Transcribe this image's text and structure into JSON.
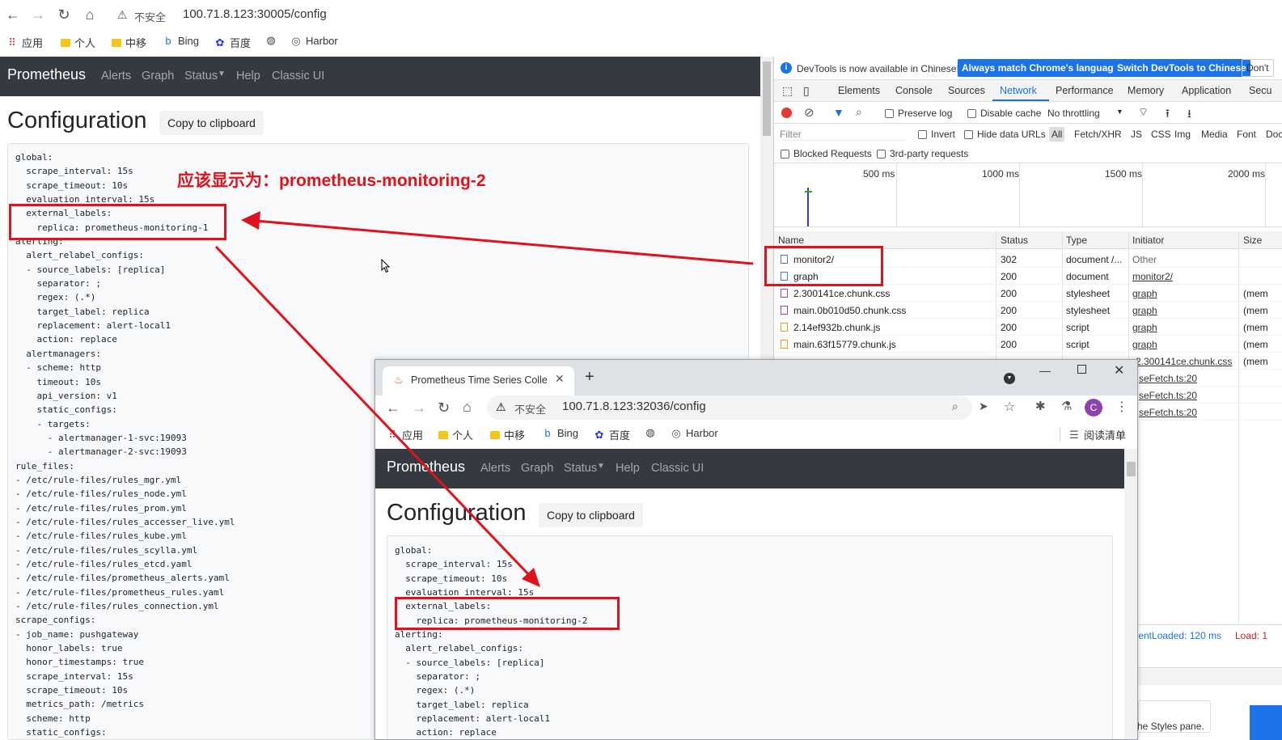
{
  "browser": {
    "url_warning": "不安全",
    "url": "100.71.8.123:30005/config",
    "bookmarks": [
      "应用",
      "个人",
      "中移",
      "Bing",
      "百度",
      "Harbor"
    ]
  },
  "prometheus": {
    "brand": "Prometheus",
    "nav": [
      "Alerts",
      "Graph",
      "Status",
      "Help",
      "Classic UI"
    ],
    "page_title": "Configuration",
    "copy_button": "Copy to clipboard",
    "config_text": "global:\n  scrape_interval: 15s\n  scrape_timeout: 10s\n  evaluation_interval: 15s\n  external_labels:\n    replica: prometheus-monitoring-1\nalerting:\n  alert_relabel_configs:\n  - source_labels: [replica]\n    separator: ;\n    regex: (.*)\n    target_label: replica\n    replacement: alert-local1\n    action: replace\n  alertmanagers:\n  - scheme: http\n    timeout: 10s\n    api_version: v1\n    static_configs:\n    - targets:\n      - alertmanager-1-svc:19093\n      - alertmanager-2-svc:19093\nrule_files:\n- /etc/rule-files/rules_mgr.yml\n- /etc/rule-files/rules_node.yml\n- /etc/rule-files/rules_prom.yml\n- /etc/rule-files/rules_accesser_live.yml\n- /etc/rule-files/rules_kube.yml\n- /etc/rule-files/rules_scylla.yml\n- /etc/rule-files/rules_etcd.yaml\n- /etc/rule-files/prometheus_alerts.yaml\n- /etc/rule-files/prometheus_rules.yaml\n- /etc/rule-files/rules_connection.yml\nscrape_configs:\n- job_name: pushgateway\n  honor_labels: true\n  honor_timestamps: true\n  scrape_interval: 15s\n  scrape_timeout: 10s\n  metrics_path: /metrics\n  scheme: http\n  static_configs:"
  },
  "annotation": {
    "text": "应该显示为：prometheus-monitoring-2",
    "color": "#e0131c"
  },
  "devtools": {
    "banner": "DevTools is now available in Chinese!",
    "banner_btn1": "Always match Chrome's language",
    "banner_btn2": "Switch DevTools to Chinese",
    "banner_btn3": "Don't",
    "tabs": [
      "Elements",
      "Console",
      "Sources",
      "Network",
      "Performance",
      "Memory",
      "Application",
      "Secu"
    ],
    "active_tab": "Network",
    "preserve_log": "Preserve log",
    "disable_cache": "Disable cache",
    "throttling": "No throttling",
    "filter_placeholder": "Filter",
    "invert": "Invert",
    "hide_data_urls": "Hide data URLs",
    "type_filters": [
      "All",
      "Fetch/XHR",
      "JS",
      "CSS",
      "Img",
      "Media",
      "Font",
      "Doc"
    ],
    "blocked_requests": "Blocked Requests",
    "third_party": "3rd-party requests",
    "timeline_ticks": [
      "500 ms",
      "1000 ms",
      "1500 ms",
      "2000 ms"
    ],
    "columns": [
      "Name",
      "Status",
      "Type",
      "Initiator",
      "Size"
    ],
    "rows": [
      {
        "name": "monitor2/",
        "status": "302",
        "type": "document /...",
        "initiator": "Other",
        "size": ""
      },
      {
        "name": "graph",
        "status": "200",
        "type": "document",
        "initiator": "monitor2/",
        "size": ""
      },
      {
        "name": "2.300141ce.chunk.css",
        "status": "200",
        "type": "stylesheet",
        "initiator": "graph",
        "size": "(mem"
      },
      {
        "name": "main.0b010d50.chunk.css",
        "status": "200",
        "type": "stylesheet",
        "initiator": "graph",
        "size": "(mem"
      },
      {
        "name": "2.14ef932b.chunk.js",
        "status": "200",
        "type": "script",
        "initiator": "graph",
        "size": "(mem"
      },
      {
        "name": "main.63f15779.chunk.js",
        "status": "200",
        "type": "script",
        "initiator": "graph",
        "size": "(mem"
      },
      {
        "name": "",
        "status": "",
        "type": "",
        "initiator": "2.300141ce.chunk.css",
        "size": "(mem"
      },
      {
        "name": "",
        "status": "",
        "type": "",
        "initiator": "seFetch.ts:20",
        "size": ""
      },
      {
        "name": "",
        "status": "",
        "type": "",
        "initiator": "seFetch.ts:20",
        "size": ""
      },
      {
        "name": "",
        "status": "",
        "type": "",
        "initiator": "seFetch.ts:20",
        "size": ""
      }
    ],
    "dom_loaded": "tentLoaded: 120 ms",
    "load": "Load: 1",
    "styles_hint": "he Styles pane."
  },
  "popup": {
    "tab_title": "Prometheus Time Series Colle",
    "url_warning": "不安全",
    "url": "100.71.8.123:32036/config",
    "bookmarks": [
      "应用",
      "个人",
      "中移",
      "Bing",
      "百度",
      "Harbor"
    ],
    "reading_list": "阅读清单",
    "profile_letter": "C",
    "config_text": "global:\n  scrape_interval: 15s\n  scrape_timeout: 10s\n  evaluation_interval: 15s\n  external_labels:\n    replica: prometheus-monitoring-2\nalerting:\n  alert_relabel_configs:\n  - source_labels: [replica]\n    separator: ;\n    regex: (.*)\n    target_label: replica\n    replacement: alert-local1\n    action: replace"
  }
}
